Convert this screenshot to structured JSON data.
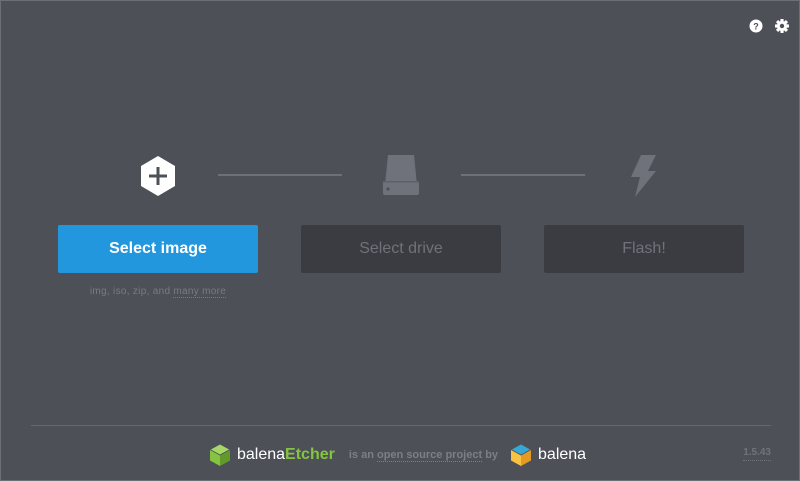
{
  "app": {
    "title": "balenaEtcher",
    "version": "1.5.43"
  },
  "topbar": {
    "help_icon": "help-circle-icon",
    "settings_icon": "gear-icon"
  },
  "steps": {
    "image": {
      "icon": "plus-hexagon-icon",
      "button_label": "Select image",
      "formats_prefix": "img, iso, zip, and",
      "formats_link": "many more"
    },
    "drive": {
      "icon": "drive-icon",
      "button_label": "Select drive"
    },
    "flash": {
      "icon": "lightning-icon",
      "button_label": "Flash!"
    }
  },
  "footer": {
    "brand_prefix": "balena",
    "brand_suffix": "Etcher",
    "tagline_is": "is an",
    "tagline_link": "open source project",
    "tagline_by": "by",
    "company": "balena"
  },
  "colors": {
    "background": "#4d5057",
    "primary": "#2297de",
    "disabled_button": "#3a3c41",
    "etcher_green": "#85c440"
  }
}
